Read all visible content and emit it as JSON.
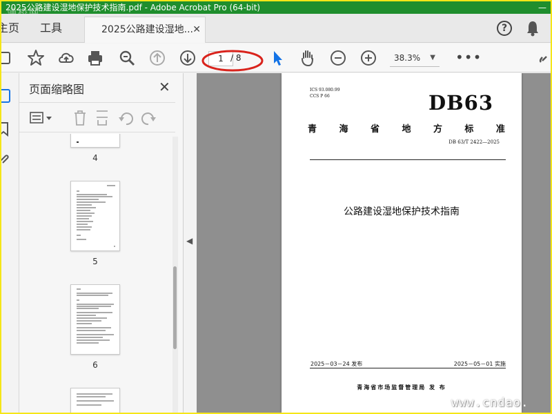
{
  "window": {
    "title": "2025公路建设湿地保护技术指南.pdf - Adobe Acrobat Pro (64-bit)",
    "watermark": "通桥网",
    "controls": "—"
  },
  "tabs": {
    "home": "主页",
    "tools": "工具",
    "document": "2025公路建设湿地...",
    "close": "✕"
  },
  "toolbar": {
    "current_page": "1",
    "total_pages": "/ 8",
    "zoom": "38.3%",
    "zoom_caret": "▼",
    "more": "•••",
    "highlight_color": "#d9231c"
  },
  "thumbnail_panel": {
    "title": "页面缩略图",
    "close": "✕",
    "pages": [
      {
        "label": "4"
      },
      {
        "label": "5"
      },
      {
        "label": "6"
      }
    ]
  },
  "document": {
    "ics": "ICS  93.080.99",
    "ccs": "CCS  P 66",
    "code": "DB63",
    "province_chars": [
      "青",
      "海",
      "省",
      "地",
      "方",
      "标",
      "准"
    ],
    "standard_number": "DB 63/T  2422—2025",
    "title": "公路建设湿地保护技术指南",
    "issue_date": "2025－03－24 发布",
    "implement_date": "2025－05－01 实施",
    "publisher": "青海省市场监督管理局    发 布"
  },
  "site_watermark": "www.cndao."
}
